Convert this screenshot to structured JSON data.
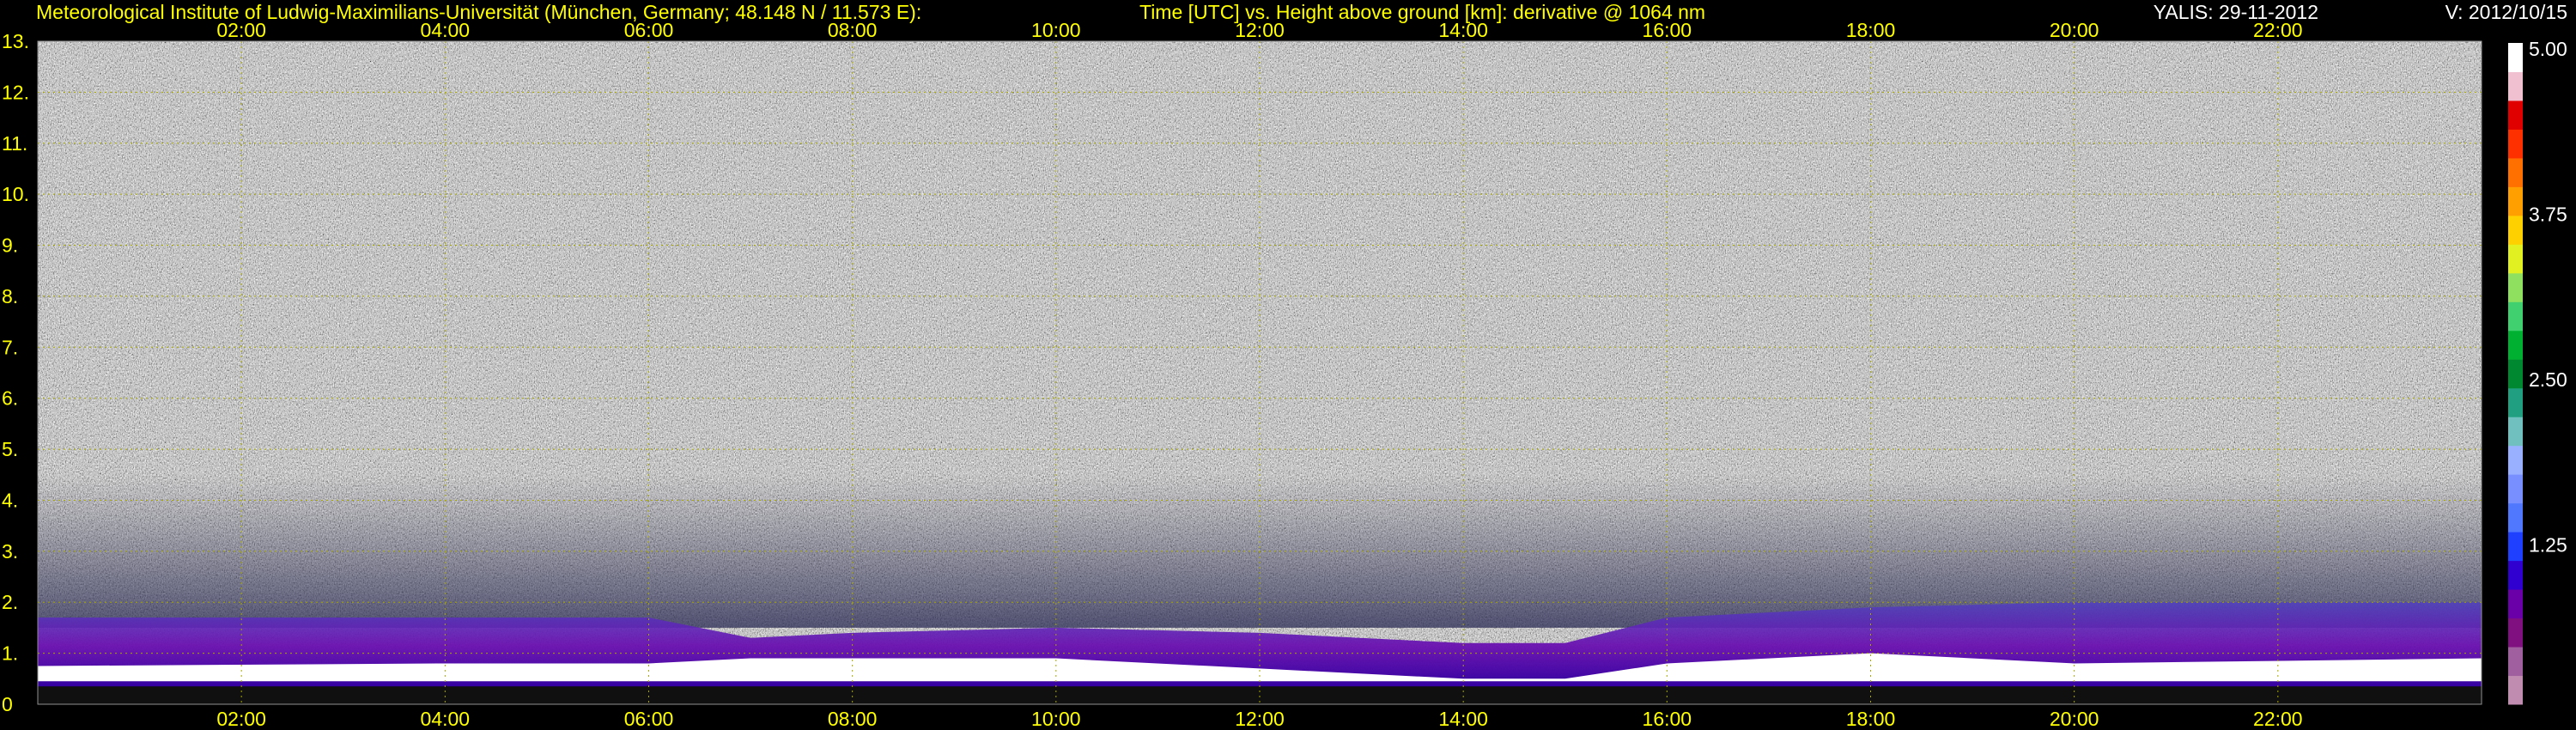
{
  "header": {
    "institute": "Meteorological Institute of Ludwig-Maximilians-Universität (München, Germany; 48.148 N / 11.573 E):",
    "description": "Time [UTC] vs. Height above ground [km]: derivative @ 1064 nm",
    "station": "YALIS: 29-11-2012",
    "version": "V: 2012/10/15"
  },
  "chart_data": {
    "type": "heatmap",
    "title": "Time [UTC] vs. Height above ground [km]: derivative @ 1064 nm",
    "xlabel": "Time [UTC]",
    "ylabel": "Height above ground [km]",
    "x_range_hours": [
      0,
      24
    ],
    "ylim": [
      0,
      13
    ],
    "x_ticks": [
      2,
      4,
      6,
      8,
      10,
      12,
      14,
      16,
      18,
      20,
      22
    ],
    "x_tick_labels": [
      "02:00",
      "04:00",
      "06:00",
      "08:00",
      "10:00",
      "12:00",
      "14:00",
      "16:00",
      "18:00",
      "20:00",
      "22:00"
    ],
    "y_ticks": [
      0,
      1,
      2,
      3,
      4,
      5,
      6,
      7,
      8,
      9,
      10,
      11,
      12,
      13
    ],
    "y_tick_labels": [
      "0",
      "1.",
      "2.",
      "3.",
      "4.",
      "5.",
      "6.",
      "7.",
      "8.",
      "9.",
      "10.",
      "11.",
      "12.",
      "13."
    ],
    "grid": true,
    "colorbar": {
      "range": [
        0,
        5
      ],
      "ticks": [
        1.25,
        2.5,
        3.75,
        5.0
      ],
      "tick_labels": [
        "1.25",
        "2.50",
        "3.75",
        "5.00"
      ],
      "colors": [
        "#c08cb0",
        "#a060a0",
        "#801080",
        "#6a00a8",
        "#3000d0",
        "#2040ff",
        "#5078ff",
        "#7890ff",
        "#98b0ff",
        "#70c0c0",
        "#20a080",
        "#008830",
        "#00b030",
        "#40d070",
        "#90e060",
        "#e0f020",
        "#ffd000",
        "#ffa000",
        "#ff7000",
        "#ff3000",
        "#e00000",
        "#f0c0d0",
        "#ffffff"
      ]
    },
    "boundary_layer_top_km": [
      {
        "t": 0.0,
        "h": 1.7
      },
      {
        "t": 1.0,
        "h": 1.7
      },
      {
        "t": 2.0,
        "h": 1.7
      },
      {
        "t": 3.0,
        "h": 1.7
      },
      {
        "t": 4.0,
        "h": 1.7
      },
      {
        "t": 5.0,
        "h": 1.7
      },
      {
        "t": 6.0,
        "h": 1.7
      },
      {
        "t": 6.5,
        "h": 1.5
      },
      {
        "t": 7.0,
        "h": 1.3
      },
      {
        "t": 8.0,
        "h": 1.4
      },
      {
        "t": 10.0,
        "h": 1.5
      },
      {
        "t": 12.0,
        "h": 1.4
      },
      {
        "t": 14.0,
        "h": 1.2
      },
      {
        "t": 15.0,
        "h": 1.2
      },
      {
        "t": 16.0,
        "h": 1.7
      },
      {
        "t": 18.0,
        "h": 1.9
      },
      {
        "t": 20.0,
        "h": 2.0
      },
      {
        "t": 22.0,
        "h": 2.0
      },
      {
        "t": 24.0,
        "h": 2.0
      }
    ],
    "cloud_layer_km": [
      {
        "t": 0.0,
        "h": 0.75
      },
      {
        "t": 4.0,
        "h": 0.8
      },
      {
        "t": 6.0,
        "h": 0.8
      },
      {
        "t": 7.0,
        "h": 0.9
      },
      {
        "t": 10.0,
        "h": 0.9
      },
      {
        "t": 12.0,
        "h": 0.7
      },
      {
        "t": 14.0,
        "h": 0.5
      },
      {
        "t": 15.0,
        "h": 0.5
      },
      {
        "t": 16.0,
        "h": 0.8
      },
      {
        "t": 18.0,
        "h": 1.0
      },
      {
        "t": 20.0,
        "h": 0.8
      },
      {
        "t": 24.0,
        "h": 0.9
      }
    ]
  }
}
